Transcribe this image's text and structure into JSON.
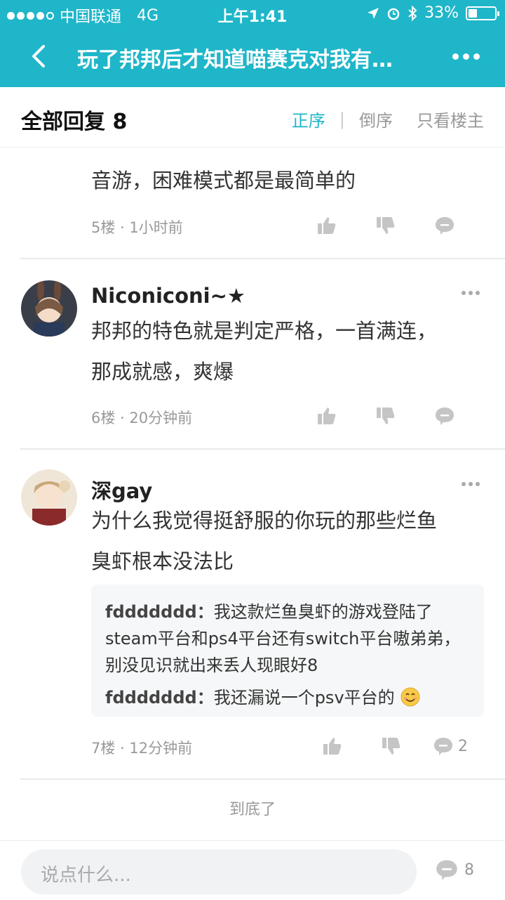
{
  "status": {
    "carrier": "中国联通",
    "network": "4G",
    "time": "上午1:41",
    "battery": "33%"
  },
  "nav": {
    "title": "玩了邦邦后才知道喵赛克对我有…"
  },
  "reply_header": {
    "label": "全部回复 8",
    "sort_asc": "正序",
    "sort_sep": "|",
    "sort_desc": "倒序",
    "only_op": "只看楼主"
  },
  "posts": [
    {
      "text_partial": "音游，困难模式都是最简单的",
      "meta": "5楼 · 1小时前"
    },
    {
      "username": "Niconiconi~★",
      "line1": "邦邦的特色就是判定严格，一首满连，",
      "line2": "那成就感，爽爆",
      "meta": "6楼 · 20分钟前"
    },
    {
      "username": "深gay",
      "line1": "为什么我觉得挺舒服的你玩的那些烂鱼",
      "line2": "臭虾根本没法比",
      "meta": "7楼 · 12分钟前",
      "reply_count": "2",
      "quotes": [
        {
          "name": "fddddddd：",
          "text": "我这款烂鱼臭虾的游戏登陆了steam平台和ps4平台还有switch平台嗷弟弟，别没见识就出来丢人现眼好8"
        },
        {
          "name": "fddddddd：",
          "text": "我还漏说一个psv平台的"
        }
      ]
    }
  ],
  "end_note": "到底了",
  "bottom": {
    "placeholder": "说点什么...",
    "comment_count": "8"
  },
  "colors": {
    "accent": "#1fb6c9"
  }
}
